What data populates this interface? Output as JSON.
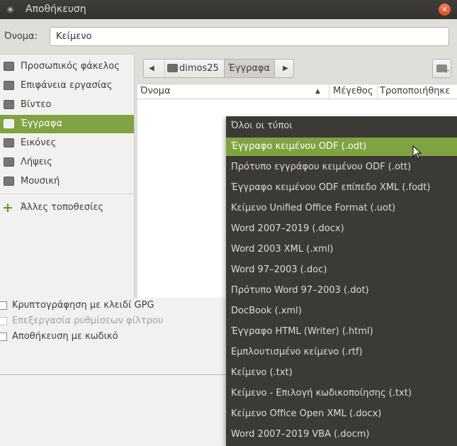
{
  "window": {
    "title": "Αποθήκευση"
  },
  "name_row": {
    "label": "Όνομα:",
    "value": "Κείμενο"
  },
  "sidebar": {
    "items": [
      {
        "label": "Προσωπικός φάκελος",
        "icon": "home-folder-icon"
      },
      {
        "label": "Επιφάνεια εργασίας",
        "icon": "desktop-icon"
      },
      {
        "label": "Βίντεο",
        "icon": "video-icon"
      },
      {
        "label": "Έγγραφα",
        "icon": "documents-icon",
        "selected": true
      },
      {
        "label": "Εικόνες",
        "icon": "pictures-icon"
      },
      {
        "label": "Λήψεις",
        "icon": "downloads-icon"
      },
      {
        "label": "Μουσική",
        "icon": "music-icon"
      }
    ],
    "other_locations": {
      "label": "Άλλες τοποθεσίες",
      "icon": "plus-icon"
    }
  },
  "pathbar": {
    "home": "dimos25",
    "current": "Έγγραφα"
  },
  "file_list": {
    "columns": {
      "name": "Όνομα",
      "size": "Μέγεθος",
      "modified": "Τροποποιήθηκε"
    }
  },
  "options": {
    "gpg": "Κρυπτογράφηση με κλειδί GPG",
    "filter": "Επεξεργασία ρυθμίσεων φίλτρου",
    "password": "Αποθήκευση με κωδικό"
  },
  "file_types": [
    "Όλοι οι τύποι",
    "Έγγραφο κειμένου ODF (.odt)",
    "Πρότυπο εγγράφου κειμένου ODF (.ott)",
    "Έγγραφο κειμένου ODF επίπεδο XML (.fodt)",
    "Κείμενο Unified Office Format (.uot)",
    "Word 2007–2019 (.docx)",
    "Word 2003 XML (.xml)",
    "Word 97–2003 (.doc)",
    "Πρότυπο Word 97–2003 (.dot)",
    "DocBook (.xml)",
    "Έγγραφο HTML (Writer) (.html)",
    "Εμπλουτισμένο κείμενο (.rtf)",
    "Κείμενο (.txt)",
    "Κείμενο - Επιλογή κωδικοποίησης (.txt)",
    "Κείμενο Office Open XML (.docx)",
    "Word 2007–2019 VBA (.docm)"
  ],
  "highlighted_type": "Έγγραφο κειμένου ODF (.odt)",
  "colors": {
    "accent": "#7ea340",
    "menu_bg": "#3b3a36",
    "titlebar": "#3a3935",
    "close": "#e95420"
  }
}
